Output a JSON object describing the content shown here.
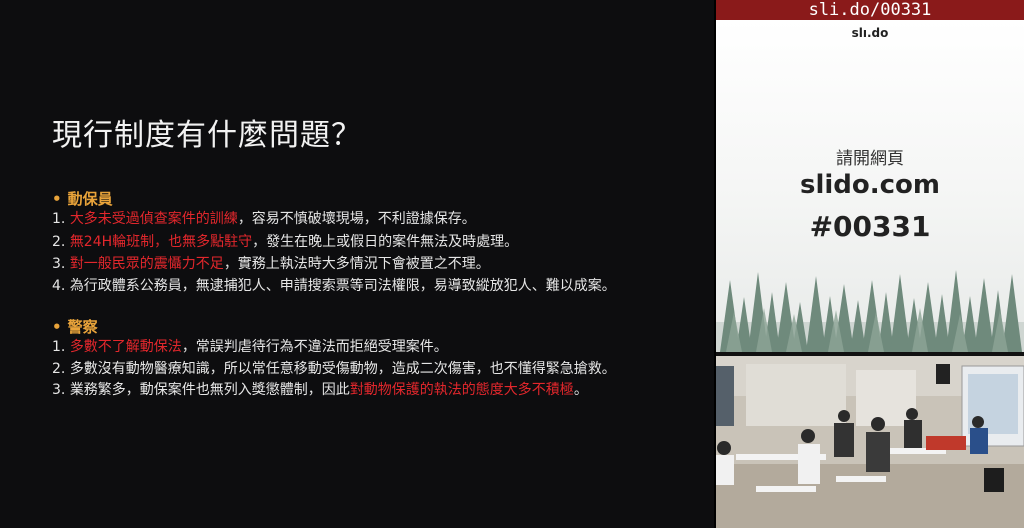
{
  "slide": {
    "title": "現行制度有什麼問題？",
    "sections": [
      {
        "label": "動保員",
        "items": [
          {
            "num": "1.",
            "highlight": "大多未受過偵查案件的訓練",
            "rest": "，容易不慎破壞現場，不利證據保存。"
          },
          {
            "num": "2.",
            "highlight": "無24H輪班制，也無多點駐守",
            "rest": "，發生在晚上或假日的案件無法及時處理。"
          },
          {
            "num": "3.",
            "highlight": "對一般民眾的震懾力不足",
            "rest": "，實務上執法時大多情況下會被置之不理。"
          },
          {
            "num": "4.",
            "highlight": "",
            "rest": "為行政體系公務員，無逮捕犯人、申請搜索票等司法權限，易導致縱放犯人、難以成案。"
          }
        ]
      },
      {
        "label": "警察",
        "items": [
          {
            "num": "1.",
            "highlight": "多數不了解動保法",
            "rest": "，常誤判虐待行為不違法而拒絕受理案件。"
          },
          {
            "num": "2.",
            "highlight": "",
            "rest": "多數沒有動物醫療知識，所以常任意移動受傷動物，造成二次傷害，也不懂得緊急搶救。"
          },
          {
            "num": "3.",
            "prefix": "業務繁多，動保案件也無列入獎懲體制，因此",
            "highlight": "對動物保護的執法的態度大多不積極",
            "rest": "。"
          }
        ]
      }
    ]
  },
  "sidebar": {
    "banner": "sli.do/00331",
    "logo": "slı.do",
    "prompt": "請開網頁",
    "url": "slido.com",
    "code": "#00331"
  },
  "colors": {
    "accent_orange": "#e8a33a",
    "highlight_red": "#e2272c",
    "banner_red": "#8a1a1a"
  }
}
